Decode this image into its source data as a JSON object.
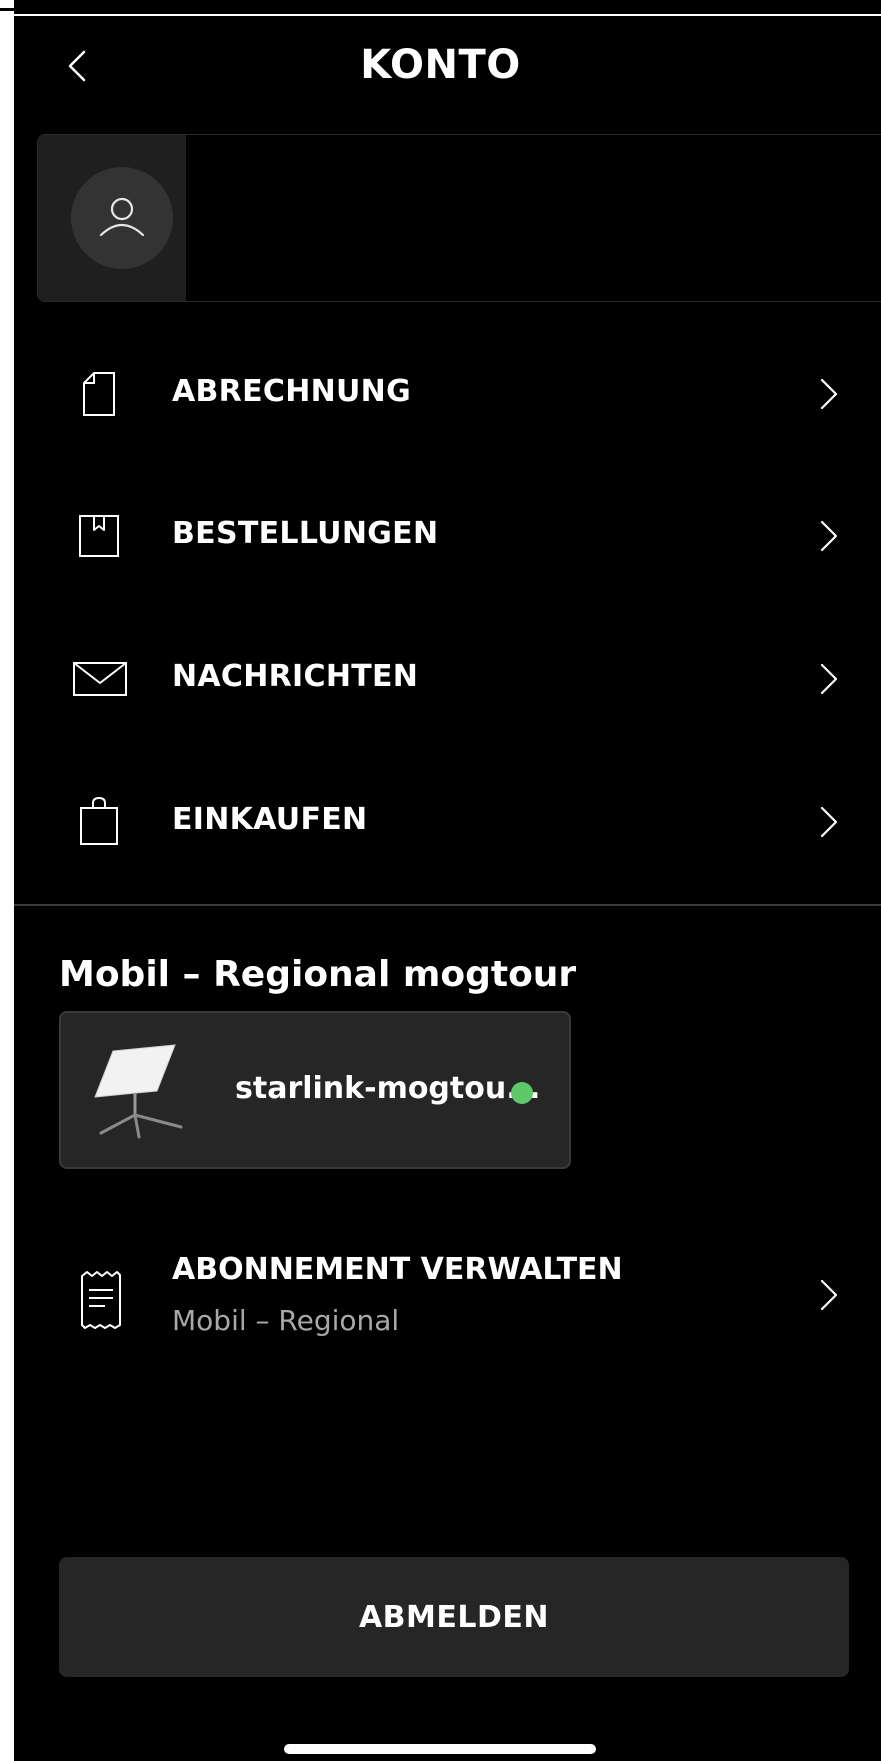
{
  "header": {
    "title": "KONTO",
    "back_icon": "chevron-left-icon"
  },
  "profile": {
    "avatar_icon": "user-icon"
  },
  "menu": {
    "items": [
      {
        "label": "ABRECHNUNG",
        "icon": "document-icon"
      },
      {
        "label": "BESTELLUNGEN",
        "icon": "box-icon"
      },
      {
        "label": "NACHRICHTEN",
        "icon": "envelope-icon"
      },
      {
        "label": "EINKAUFEN",
        "icon": "shopping-bag-icon"
      }
    ]
  },
  "section": {
    "title": "Mobil – Regional mogtour",
    "device": {
      "name": "starlink-mogtou...",
      "status_color": "#5ec96b"
    },
    "subscription": {
      "label": "ABONNEMENT VERWALTEN",
      "sublabel": "Mobil – Regional",
      "icon": "receipt-icon"
    }
  },
  "footer": {
    "logout_label": "ABMELDEN"
  }
}
